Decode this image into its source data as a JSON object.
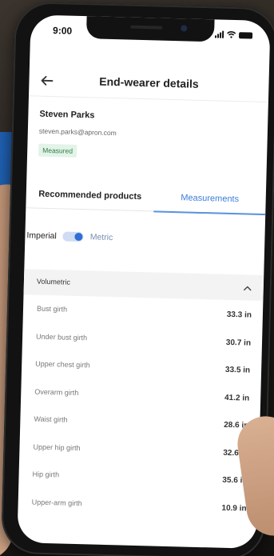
{
  "status_bar": {
    "time": "9:00"
  },
  "header": {
    "title": "End-wearer details"
  },
  "profile": {
    "name": "Steven Parks",
    "email": "steven.parks@apron.com",
    "status_badge": "Measured"
  },
  "tabs": [
    {
      "label": "Recommended products",
      "active": false
    },
    {
      "label": "Measurements",
      "active": true
    }
  ],
  "units": {
    "imperial_label": "Imperial",
    "metric_label": "Metric",
    "toggle_on": true
  },
  "section": {
    "title": "Volumetric",
    "expanded": true,
    "rows": [
      {
        "label": "Bust girth",
        "value": "33.3 in"
      },
      {
        "label": "Under bust girth",
        "value": "30.7 in"
      },
      {
        "label": "Upper chest girth",
        "value": "33.5 in"
      },
      {
        "label": "Overarm girth",
        "value": "41.2 in"
      },
      {
        "label": "Waist girth",
        "value": "28.6 in"
      },
      {
        "label": "Upper hip girth",
        "value": "32.6 in"
      },
      {
        "label": "Hip girth",
        "value": "35.6 in"
      },
      {
        "label": "Upper-arm girth",
        "value": "10.9 in"
      }
    ]
  },
  "colors": {
    "accent": "#3d7fd8",
    "badge_text": "#2e7d4a",
    "badge_bg": "#e3f3e8"
  }
}
